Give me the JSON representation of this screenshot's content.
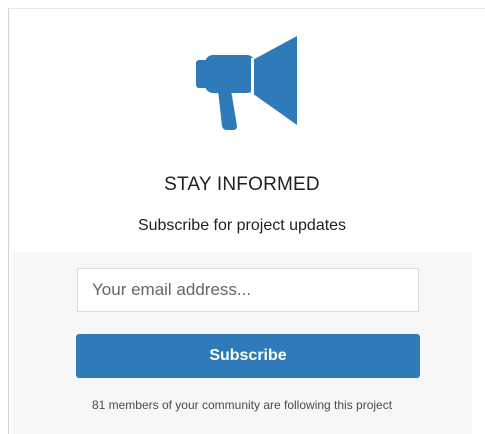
{
  "widget": {
    "heading": "STAY INFORMED",
    "subheading": "Subscribe for project updates",
    "icon": "megaphone-icon",
    "accent_color": "#2f7ab8"
  },
  "form": {
    "email_placeholder": "Your email address...",
    "email_value": "",
    "subscribe_label": "Subscribe"
  },
  "footer": {
    "followers_text": "81 members of your community are following this project"
  }
}
